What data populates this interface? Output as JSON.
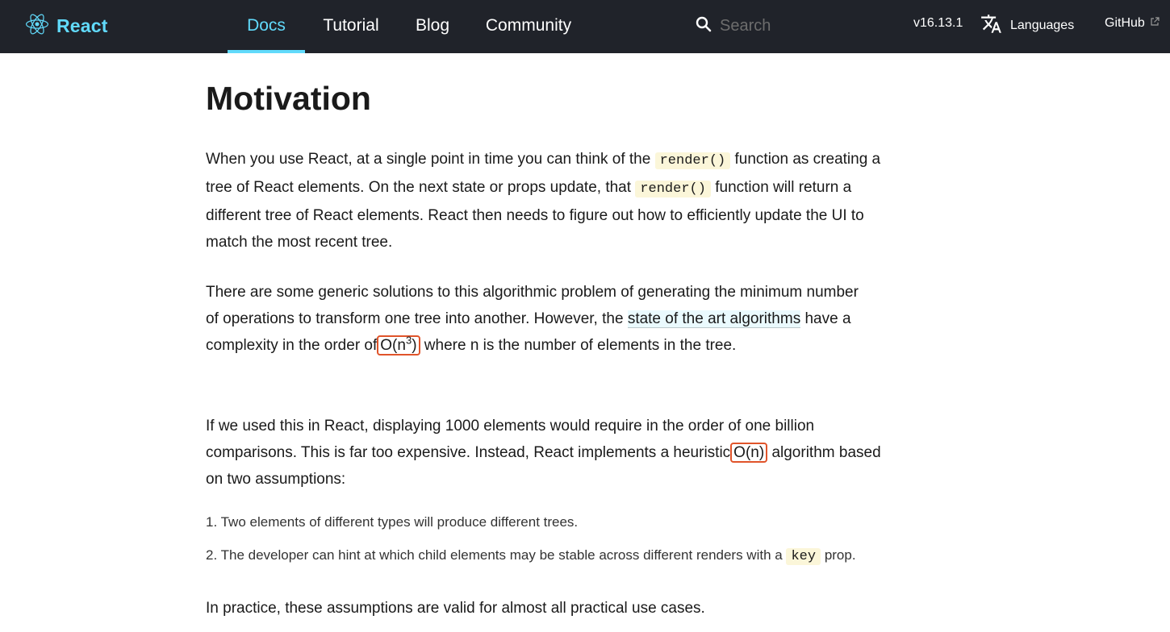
{
  "header": {
    "logo_text": "React",
    "nav": [
      {
        "label": "Docs",
        "active": true
      },
      {
        "label": "Tutorial",
        "active": false
      },
      {
        "label": "Blog",
        "active": false
      },
      {
        "label": "Community",
        "active": false
      }
    ],
    "search_placeholder": "Search",
    "version": "v16.13.1",
    "languages_label": "Languages",
    "github_label": "GitHub"
  },
  "colors": {
    "nav_bg": "#20232a",
    "accent": "#61dafb",
    "code_bg": "#fbf6d9",
    "highlight_box": "#e0542a"
  },
  "icons": [
    "react-logo-icon",
    "search-icon",
    "translate-icon",
    "external-link-icon"
  ],
  "article": {
    "title": "Motivation",
    "p1": {
      "t1": "When you use React, at a single point in time you can think of the",
      "code1": "render()",
      "t2": "function as creating a tree of React elements. On the next state or props update, that",
      "code2": "render()",
      "t3": "function will return a different tree of React elements. React then needs to figure out how to efficiently update the UI to match the most recent tree."
    },
    "p2": {
      "t1": "There are some generic solutions to this algorithmic problem of generating the minimum number of operations to transform one tree into another. However, the",
      "link": "state of the art algorithms",
      "t2": "have a complexity in the order of",
      "complexity_base": "O(n",
      "complexity_exp": "3",
      "complexity_close": ")",
      "t3": "where n is the number of elements in the tree."
    },
    "p3": {
      "t1": "If we used this in React, displaying 1000 elements would require in the order of one billion comparisons. This is far too expensive. Instead, React implements a heuristic",
      "complexity": "O(n)",
      "t2": "algorithm based on two assumptions:"
    },
    "assumptions": [
      {
        "num": "1.",
        "text": "Two elements of different types will produce different trees."
      },
      {
        "num": "2.",
        "text": "The developer can hint at which child elements may be stable across different renders with a",
        "code": "key",
        "text_after": "prop."
      }
    ],
    "p4": "In practice, these assumptions are valid for almost all practical use cases."
  }
}
